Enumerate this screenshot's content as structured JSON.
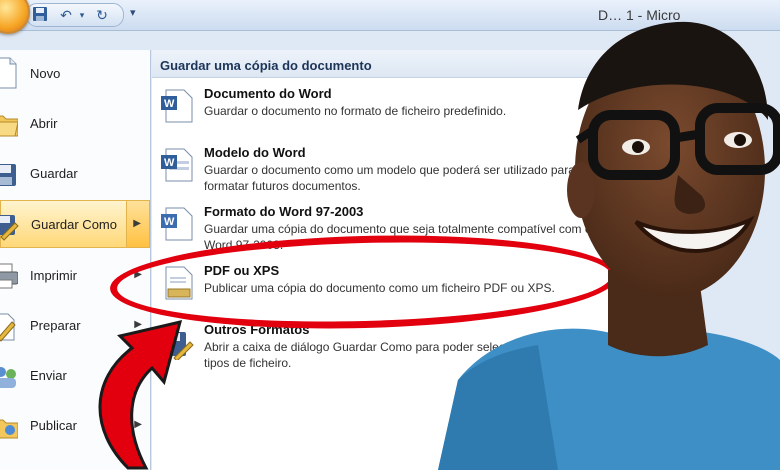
{
  "window": {
    "title": "D… 1 - Micro"
  },
  "quick_access": {
    "dropdown_glyph": "▾"
  },
  "left_menu": {
    "items": [
      {
        "label": "Novo",
        "icon": "new-document-icon",
        "has_arrow": false
      },
      {
        "label": "Abrir",
        "icon": "open-folder-icon",
        "has_arrow": false
      },
      {
        "label": "Guardar",
        "icon": "save-disk-icon",
        "has_arrow": false
      },
      {
        "label": "Guardar Como",
        "icon": "save-as-icon",
        "has_arrow": true,
        "selected": true
      },
      {
        "label": "Imprimir",
        "icon": "printer-icon",
        "has_arrow": true
      },
      {
        "label": "Preparar",
        "icon": "prepare-pen-icon",
        "has_arrow": true
      },
      {
        "label": "Enviar",
        "icon": "send-people-icon",
        "has_arrow": true
      },
      {
        "label": "Publicar",
        "icon": "publish-folder-icon",
        "has_arrow": true
      }
    ]
  },
  "submenu": {
    "title": "Guardar uma cópia do documento",
    "options": [
      {
        "title": "Documento do Word",
        "desc": "Guardar o documento no formato de ficheiro predefinido.",
        "icon": "word-document-icon"
      },
      {
        "title": "Modelo do Word",
        "desc": "Guardar o documento como um modelo que poderá ser utilizado para formatar futuros documentos.",
        "icon": "word-template-icon"
      },
      {
        "title": "Formato do Word 97-2003",
        "desc": "Guardar uma cópia do documento que seja totalmente compatível com o Word 97-2003.",
        "icon": "word-97-2003-icon"
      },
      {
        "title": "PDF ou XPS",
        "desc": "Publicar uma cópia do documento como um ficheiro PDF ou XPS.",
        "icon": "pdf-xps-icon"
      },
      {
        "title": "Outros Formatos",
        "desc": "Abrir a caixa de diálogo Guardar Como para poder seleccionar todos os tipos de ficheiro.",
        "icon": "other-formats-icon"
      }
    ]
  },
  "annotation": {
    "color": "#e2000f"
  },
  "colors": {
    "selected_bg": "#ffd878",
    "header_text": "#1c3458",
    "accent": "#2e5b93"
  }
}
